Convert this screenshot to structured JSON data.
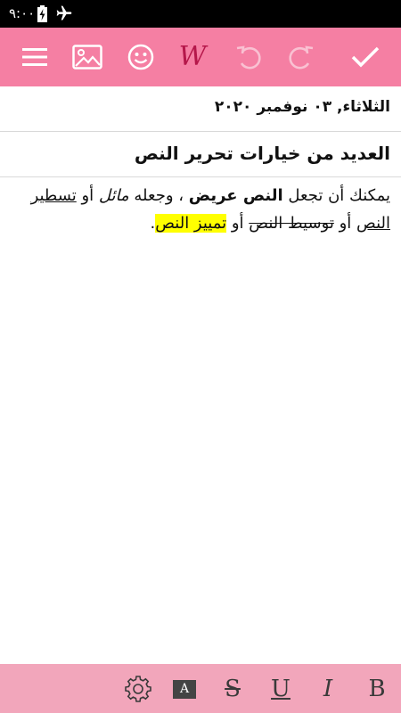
{
  "status_bar": {
    "time": "٩:٠٠"
  },
  "toolbar": {
    "format_label": "W",
    "icons": [
      "menu-icon",
      "image-icon",
      "emoji-icon",
      "format-icon",
      "undo-icon",
      "redo-icon",
      "check-icon"
    ]
  },
  "note": {
    "date": "الثلاثاء, ٠٣ نوفمبر ٢٠٢٠",
    "title": "العديد من خيارات تحرير النص",
    "body": {
      "s1": "يمكنك أن تجعل ",
      "bold": "النص عريض",
      "s2": " ، وجعله ",
      "italic": "مائل",
      "s3": " أو ",
      "underline": "تسطير النص",
      "s4": " أو ",
      "strike": "توسيط النص",
      "s5": " أو ",
      "highlight": "تمييز النص",
      "s6": "."
    }
  },
  "format_bar": {
    "bold_label": "B",
    "italic_label": "I",
    "underline_label": "U",
    "strike_label": "S",
    "font_label": "A",
    "accent_color": "#f57fa3",
    "bar_color": "#f2a6bb",
    "highlight_color": "#ffff00"
  }
}
